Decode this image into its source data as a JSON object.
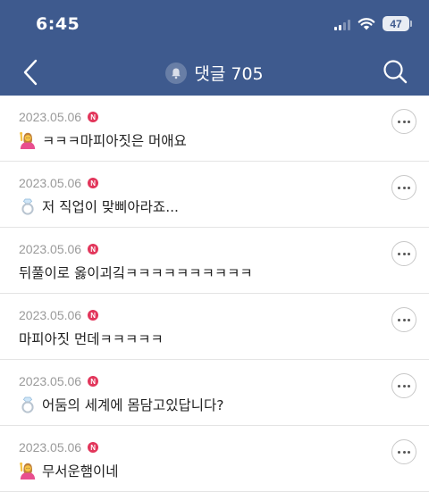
{
  "status_bar": {
    "time": "6:45",
    "battery": "47"
  },
  "nav": {
    "back_icon": "chevron-left-icon",
    "title": "댓글 705",
    "title_icon": "bell-icon",
    "search_icon": "search-icon"
  },
  "colors": {
    "header_bg": "#3e5a8e",
    "badge": "#e2365b"
  },
  "comments": [
    {
      "date": "2023.05.06",
      "badge": "N",
      "emoji": "person-raising-hand-icon",
      "text": "ㅋㅋㅋ마피아짓은 머애요"
    },
    {
      "date": "2023.05.06",
      "badge": "N",
      "emoji": "ring-icon",
      "text": "저 직업이 맞삐아라죠..."
    },
    {
      "date": "2023.05.06",
      "badge": "N",
      "emoji": "",
      "text": "뒤풀이로 옳이괴깈ㅋㅋㅋㅋㅋㅋㅋㅋㅋㅋ"
    },
    {
      "date": "2023.05.06",
      "badge": "N",
      "emoji": "",
      "text": "마피아짓 먼데ㅋㅋㅋㅋㅋ"
    },
    {
      "date": "2023.05.06",
      "badge": "N",
      "emoji": "ring-icon",
      "text": "어둠의 세계에 몸담고있답니다?"
    },
    {
      "date": "2023.05.06",
      "badge": "N",
      "emoji": "person-raising-hand-icon",
      "text": "무서운햄이네"
    }
  ]
}
